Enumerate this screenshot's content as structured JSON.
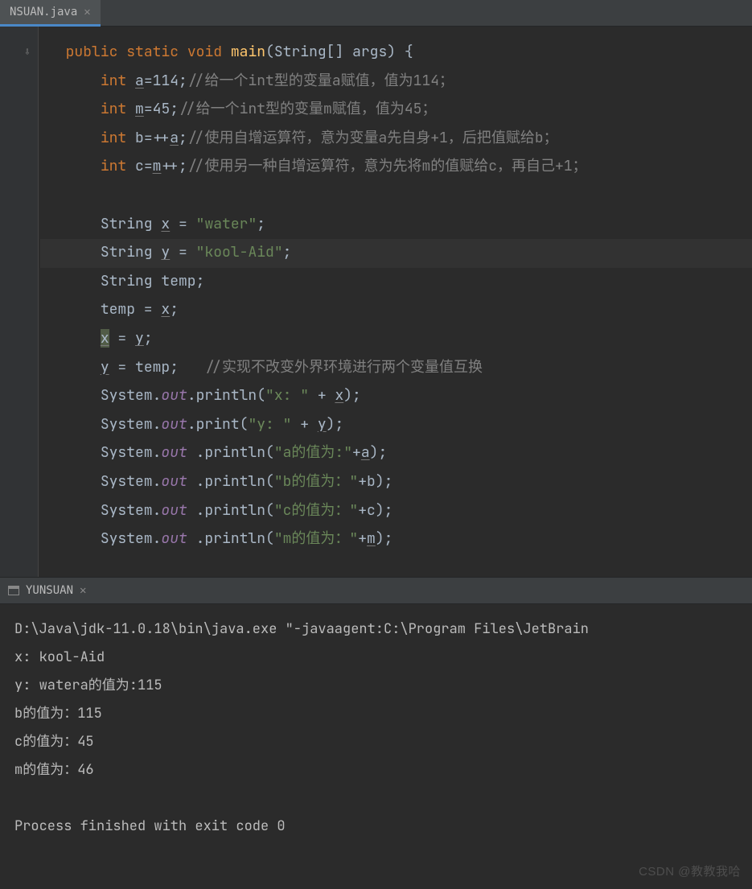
{
  "tab": {
    "label": "NSUAN.java"
  },
  "terminal_tab": {
    "label": "YUNSUAN"
  },
  "watermark": "CSDN @教教我哈",
  "code": {
    "l1": {
      "kw_public": "public",
      "kw_static": "static",
      "kw_void": "void",
      "mname": "main",
      "sig": "(String[] args) {"
    },
    "l2": {
      "kw": "int",
      "var": "a",
      "assign": "=114;",
      "cmt": "//给一个int型的变量a赋值，值为114；"
    },
    "l3": {
      "kw": "int",
      "var": "m",
      "assign": "=45;",
      "cmt": "//给一个int型的变量m赋值，值为45；"
    },
    "l4": {
      "kw": "int",
      "txt1": " b=++",
      "var": "a",
      "semi": ";",
      "cmt": "//使用自增运算符，意为变量a先自身+1，后把值赋给b；"
    },
    "l5": {
      "kw": "int",
      "txt1": " c=",
      "var": "m",
      "rest": "++;",
      "cmt": "//使用另一种自增运算符，意为先将m的值赋给c，再自己+1；"
    },
    "l7": {
      "txt": "String ",
      "var": "x",
      "eq": " = ",
      "str": "\"water\"",
      "semi": ";"
    },
    "l8": {
      "txt": "String ",
      "var": "y",
      "eq": " = ",
      "str": "\"kool-Aid\"",
      "semi": ";"
    },
    "l9": {
      "txt": "String temp;"
    },
    "l10": {
      "txt1": "temp = ",
      "var": "x",
      "semi": ";"
    },
    "l11": {
      "var1": "x",
      "eq": " = ",
      "var2": "y",
      "semi": ";"
    },
    "l12": {
      "var1": "y",
      "rest": " = temp;   ",
      "cmt": "//实现不改变外界环境进行两个变量值互换"
    },
    "l13": {
      "sys": "System.",
      "out": "out",
      "call": ".println(",
      "str": "\"x: \"",
      "plus": " + ",
      "var": "x",
      "end": ");"
    },
    "l14": {
      "sys": "System.",
      "out": "out",
      "call": ".print(",
      "str": "\"y: \"",
      "plus": " + ",
      "var": "y",
      "end": ");"
    },
    "l15": {
      "sys": "System.",
      "out": "out",
      "call": " .println(",
      "str": "\"a的值为:\"",
      "plus": "+",
      "var": "a",
      "end": ");"
    },
    "l16": {
      "sys": "System.",
      "out": "out",
      "call": " .println(",
      "str": "\"b的值为：\"",
      "plus": "+b);",
      "var": "",
      "end": ""
    },
    "l17": {
      "sys": "System.",
      "out": "out",
      "call": " .println(",
      "str": "\"c的值为：\"",
      "plus": "+c);",
      "var": "",
      "end": ""
    },
    "l18": {
      "sys": "System.",
      "out": "out",
      "call": " .println(",
      "str": "\"m的值为：\"",
      "plus": "+",
      "var": "m",
      "end": ");"
    }
  },
  "console": {
    "l1": "D:\\Java\\jdk-11.0.18\\bin\\java.exe \"-javaagent:C:\\Program Files\\JetBrain",
    "l2": "x: kool-Aid",
    "l3": "y: watera的值为:115",
    "l4": "b的值为：115",
    "l5": "c的值为：45",
    "l6": "m的值为：46",
    "l7": "",
    "l8": "Process finished with exit code 0"
  }
}
